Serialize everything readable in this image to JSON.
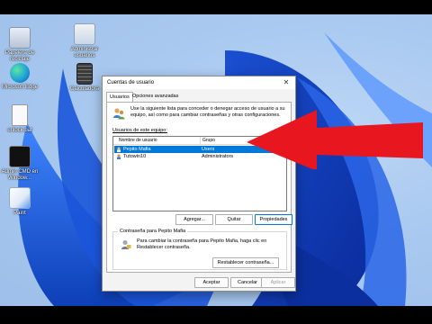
{
  "desktop": {
    "icons": [
      {
        "label": "Papelera de reciclaje",
        "icon": "recycle-bin-icon"
      },
      {
        "label": "Microsoft Edge",
        "icon": "edge-icon"
      },
      {
        "label": "unlock.bat",
        "icon": "document-icon"
      },
      {
        "label": "Admin CMD en Window...",
        "icon": "console-icon"
      },
      {
        "label": "Paint",
        "icon": "paint-icon"
      },
      {
        "label": "Administrar usuarios",
        "icon": "shortcut-icon"
      },
      {
        "label": "Calculadora",
        "icon": "calculator-icon"
      }
    ]
  },
  "dialog": {
    "title": "Cuentas de usuario",
    "close_glyph": "✕",
    "tabs": [
      {
        "label": "Usuarios",
        "active": true
      },
      {
        "label": "Opciones avanzadas",
        "active": false
      }
    ],
    "info_text": "Use la siguiente lista para conceder o denegar acceso de usuario a su equipo, así como para cambiar contraseñas y otras configuraciones.",
    "users_label": "Usuarios de este equipo:",
    "columns": [
      "Nombre de usuario",
      "Grupo"
    ],
    "users": [
      {
        "name": "Pepito Mafia",
        "group": "Users",
        "selected": true
      },
      {
        "name": "Tutowin10",
        "group": "Administrators",
        "selected": false
      }
    ],
    "buttons": {
      "add": "Agregar...",
      "remove": "Quitar",
      "properties": "Propiedades"
    },
    "password_group": {
      "legend": "Contraseña para Pepito Mafia",
      "text": "Para cambiar la contraseña para Pepito Mafia, haga clic en Restablecer contraseña.",
      "reset_button": "Restablecer contraseña..."
    },
    "footer": {
      "ok": "Aceptar",
      "cancel": "Cancelar",
      "apply": "Aplicar"
    }
  },
  "colors": {
    "accent": "#0078d7",
    "arrow": "#e8161e"
  }
}
